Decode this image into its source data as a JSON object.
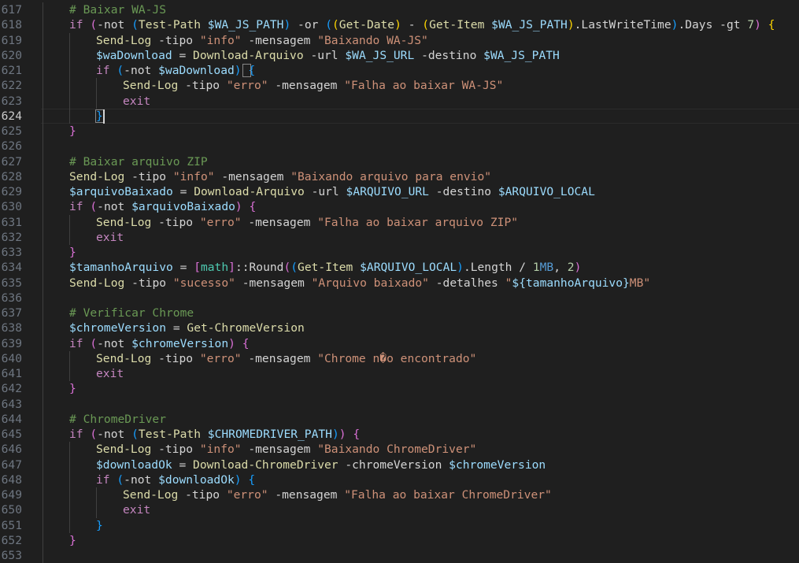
{
  "editor": {
    "cursor_line": 624,
    "lines": [
      {
        "num": "617",
        "indent": 1,
        "tokens": [
          [
            "com",
            "# Baixar WA-JS"
          ]
        ]
      },
      {
        "num": "618",
        "indent": 1,
        "tokens": [
          [
            "kw",
            "if"
          ],
          [
            "txt",
            " "
          ],
          [
            "p2",
            "("
          ],
          [
            "op",
            "-not"
          ],
          [
            "txt",
            " "
          ],
          [
            "p3",
            "("
          ],
          [
            "cmd",
            "Test-Path"
          ],
          [
            "txt",
            " "
          ],
          [
            "var",
            "$WA_JS_PATH"
          ],
          [
            "p3",
            ")"
          ],
          [
            "txt",
            " "
          ],
          [
            "op",
            "-or"
          ],
          [
            "txt",
            " "
          ],
          [
            "p3",
            "("
          ],
          [
            "p1",
            "("
          ],
          [
            "cmd",
            "Get-Date"
          ],
          [
            "p1",
            ")"
          ],
          [
            "txt",
            " "
          ],
          [
            "op",
            "-"
          ],
          [
            "txt",
            " "
          ],
          [
            "p1",
            "("
          ],
          [
            "cmd",
            "Get-Item"
          ],
          [
            "txt",
            " "
          ],
          [
            "var",
            "$WA_JS_PATH"
          ],
          [
            "p1",
            ")"
          ],
          [
            "txt",
            ".LastWriteTime"
          ],
          [
            "p3",
            ")"
          ],
          [
            "txt",
            ".Days "
          ],
          [
            "op",
            "-gt"
          ],
          [
            "txt",
            " "
          ],
          [
            "num",
            "7"
          ],
          [
            "p2",
            ")"
          ],
          [
            "txt",
            " "
          ],
          [
            "p1",
            "{"
          ]
        ]
      },
      {
        "num": "619",
        "indent": 2,
        "tokens": [
          [
            "cmd",
            "Send-Log"
          ],
          [
            "txt",
            " "
          ],
          [
            "op",
            "-tipo"
          ],
          [
            "txt",
            " "
          ],
          [
            "str",
            "\"info\""
          ],
          [
            "txt",
            " "
          ],
          [
            "op",
            "-mensagem"
          ],
          [
            "txt",
            " "
          ],
          [
            "str",
            "\"Baixando WA-JS\""
          ]
        ]
      },
      {
        "num": "620",
        "indent": 2,
        "tokens": [
          [
            "var",
            "$waDownload"
          ],
          [
            "txt",
            " "
          ],
          [
            "op",
            "="
          ],
          [
            "txt",
            " "
          ],
          [
            "cmd",
            "Download-Arquivo"
          ],
          [
            "txt",
            " "
          ],
          [
            "op",
            "-url"
          ],
          [
            "txt",
            " "
          ],
          [
            "var",
            "$WA_JS_URL"
          ],
          [
            "txt",
            " "
          ],
          [
            "op",
            "-destino"
          ],
          [
            "txt",
            " "
          ],
          [
            "var",
            "$WA_JS_PATH"
          ]
        ]
      },
      {
        "num": "621",
        "indent": 2,
        "tokens": [
          [
            "kw",
            "if"
          ],
          [
            "txt",
            " "
          ],
          [
            "p3",
            "("
          ],
          [
            "op",
            "-not"
          ],
          [
            "txt",
            " "
          ],
          [
            "var",
            "$waDownload"
          ],
          [
            "p3",
            ")"
          ],
          [
            "txt",
            " "
          ],
          [
            "p3",
            "{"
          ]
        ]
      },
      {
        "num": "622",
        "indent": 3,
        "tokens": [
          [
            "cmd",
            "Send-Log"
          ],
          [
            "txt",
            " "
          ],
          [
            "op",
            "-tipo"
          ],
          [
            "txt",
            " "
          ],
          [
            "str",
            "\"erro\""
          ],
          [
            "txt",
            " "
          ],
          [
            "op",
            "-mensagem"
          ],
          [
            "txt",
            " "
          ],
          [
            "str",
            "\"Falha ao baixar WA-JS\""
          ]
        ]
      },
      {
        "num": "623",
        "indent": 3,
        "tokens": [
          [
            "kw",
            "exit"
          ]
        ]
      },
      {
        "num": "624",
        "indent": 2,
        "tokens": [
          [
            "p3",
            "}"
          ]
        ]
      },
      {
        "num": "625",
        "indent": 1,
        "tokens": [
          [
            "p2",
            "}"
          ]
        ]
      },
      {
        "num": "626",
        "indent": 0,
        "tokens": []
      },
      {
        "num": "627",
        "indent": 1,
        "tokens": [
          [
            "com",
            "# Baixar arquivo ZIP"
          ]
        ]
      },
      {
        "num": "628",
        "indent": 1,
        "tokens": [
          [
            "cmd",
            "Send-Log"
          ],
          [
            "txt",
            " "
          ],
          [
            "op",
            "-tipo"
          ],
          [
            "txt",
            " "
          ],
          [
            "str",
            "\"info\""
          ],
          [
            "txt",
            " "
          ],
          [
            "op",
            "-mensagem"
          ],
          [
            "txt",
            " "
          ],
          [
            "str",
            "\"Baixando arquivo para envio\""
          ]
        ]
      },
      {
        "num": "629",
        "indent": 1,
        "tokens": [
          [
            "var",
            "$arquivoBaixado"
          ],
          [
            "txt",
            " "
          ],
          [
            "op",
            "="
          ],
          [
            "txt",
            " "
          ],
          [
            "cmd",
            "Download-Arquivo"
          ],
          [
            "txt",
            " "
          ],
          [
            "op",
            "-url"
          ],
          [
            "txt",
            " "
          ],
          [
            "var",
            "$ARQUIVO_URL"
          ],
          [
            "txt",
            " "
          ],
          [
            "op",
            "-destino"
          ],
          [
            "txt",
            " "
          ],
          [
            "var",
            "$ARQUIVO_LOCAL"
          ]
        ]
      },
      {
        "num": "630",
        "indent": 1,
        "tokens": [
          [
            "kw",
            "if"
          ],
          [
            "txt",
            " "
          ],
          [
            "p2",
            "("
          ],
          [
            "op",
            "-not"
          ],
          [
            "txt",
            " "
          ],
          [
            "var",
            "$arquivoBaixado"
          ],
          [
            "p2",
            ")"
          ],
          [
            "txt",
            " "
          ],
          [
            "p2",
            "{"
          ]
        ]
      },
      {
        "num": "631",
        "indent": 2,
        "tokens": [
          [
            "cmd",
            "Send-Log"
          ],
          [
            "txt",
            " "
          ],
          [
            "op",
            "-tipo"
          ],
          [
            "txt",
            " "
          ],
          [
            "str",
            "\"erro\""
          ],
          [
            "txt",
            " "
          ],
          [
            "op",
            "-mensagem"
          ],
          [
            "txt",
            " "
          ],
          [
            "str",
            "\"Falha ao baixar arquivo ZIP\""
          ]
        ]
      },
      {
        "num": "632",
        "indent": 2,
        "tokens": [
          [
            "kw",
            "exit"
          ]
        ]
      },
      {
        "num": "633",
        "indent": 1,
        "tokens": [
          [
            "p2",
            "}"
          ]
        ]
      },
      {
        "num": "634",
        "indent": 1,
        "tokens": [
          [
            "var",
            "$tamanhoArquivo"
          ],
          [
            "txt",
            " "
          ],
          [
            "op",
            "="
          ],
          [
            "txt",
            " "
          ],
          [
            "p2",
            "["
          ],
          [
            "type",
            "math"
          ],
          [
            "p2",
            "]"
          ],
          [
            "txt",
            "::Round"
          ],
          [
            "p2",
            "("
          ],
          [
            "p3",
            "("
          ],
          [
            "cmd",
            "Get-Item"
          ],
          [
            "txt",
            " "
          ],
          [
            "var",
            "$ARQUIVO_LOCAL"
          ],
          [
            "p3",
            ")"
          ],
          [
            "txt",
            ".Length "
          ],
          [
            "op",
            "/"
          ],
          [
            "txt",
            " "
          ],
          [
            "num",
            "1"
          ],
          [
            "unit",
            "MB"
          ],
          [
            "txt",
            ", "
          ],
          [
            "num",
            "2"
          ],
          [
            "p2",
            ")"
          ]
        ]
      },
      {
        "num": "635",
        "indent": 1,
        "tokens": [
          [
            "cmd",
            "Send-Log"
          ],
          [
            "txt",
            " "
          ],
          [
            "op",
            "-tipo"
          ],
          [
            "txt",
            " "
          ],
          [
            "str",
            "\"sucesso\""
          ],
          [
            "txt",
            " "
          ],
          [
            "op",
            "-mensagem"
          ],
          [
            "txt",
            " "
          ],
          [
            "str",
            "\"Arquivo baixado\""
          ],
          [
            "txt",
            " "
          ],
          [
            "op",
            "-detalhes"
          ],
          [
            "txt",
            " "
          ],
          [
            "str",
            "\""
          ],
          [
            "var",
            "${tamanhoArquivo}"
          ],
          [
            "str",
            "MB\""
          ]
        ]
      },
      {
        "num": "636",
        "indent": 0,
        "tokens": []
      },
      {
        "num": "637",
        "indent": 1,
        "tokens": [
          [
            "com",
            "# Verificar Chrome"
          ]
        ]
      },
      {
        "num": "638",
        "indent": 1,
        "tokens": [
          [
            "var",
            "$chromeVersion"
          ],
          [
            "txt",
            " "
          ],
          [
            "op",
            "="
          ],
          [
            "txt",
            " "
          ],
          [
            "cmd",
            "Get-ChromeVersion"
          ]
        ]
      },
      {
        "num": "639",
        "indent": 1,
        "tokens": [
          [
            "kw",
            "if"
          ],
          [
            "txt",
            " "
          ],
          [
            "p2",
            "("
          ],
          [
            "op",
            "-not"
          ],
          [
            "txt",
            " "
          ],
          [
            "var",
            "$chromeVersion"
          ],
          [
            "p2",
            ")"
          ],
          [
            "txt",
            " "
          ],
          [
            "p2",
            "{"
          ]
        ]
      },
      {
        "num": "640",
        "indent": 2,
        "tokens": [
          [
            "cmd",
            "Send-Log"
          ],
          [
            "txt",
            " "
          ],
          [
            "op",
            "-tipo"
          ],
          [
            "txt",
            " "
          ],
          [
            "str",
            "\"erro\""
          ],
          [
            "txt",
            " "
          ],
          [
            "op",
            "-mensagem"
          ],
          [
            "txt",
            " "
          ],
          [
            "str",
            "\"Chrome n�o encontrado\""
          ]
        ]
      },
      {
        "num": "641",
        "indent": 2,
        "tokens": [
          [
            "kw",
            "exit"
          ]
        ]
      },
      {
        "num": "642",
        "indent": 1,
        "tokens": [
          [
            "p2",
            "}"
          ]
        ]
      },
      {
        "num": "643",
        "indent": 0,
        "tokens": []
      },
      {
        "num": "644",
        "indent": 1,
        "tokens": [
          [
            "com",
            "# ChromeDriver"
          ]
        ]
      },
      {
        "num": "645",
        "indent": 1,
        "tokens": [
          [
            "kw",
            "if"
          ],
          [
            "txt",
            " "
          ],
          [
            "p2",
            "("
          ],
          [
            "op",
            "-not"
          ],
          [
            "txt",
            " "
          ],
          [
            "p3",
            "("
          ],
          [
            "cmd",
            "Test-Path"
          ],
          [
            "txt",
            " "
          ],
          [
            "var",
            "$CHROMEDRIVER_PATH"
          ],
          [
            "p3",
            ")"
          ],
          [
            "p2",
            ")"
          ],
          [
            "txt",
            " "
          ],
          [
            "p2",
            "{"
          ]
        ]
      },
      {
        "num": "646",
        "indent": 2,
        "tokens": [
          [
            "cmd",
            "Send-Log"
          ],
          [
            "txt",
            " "
          ],
          [
            "op",
            "-tipo"
          ],
          [
            "txt",
            " "
          ],
          [
            "str",
            "\"info\""
          ],
          [
            "txt",
            " "
          ],
          [
            "op",
            "-mensagem"
          ],
          [
            "txt",
            " "
          ],
          [
            "str",
            "\"Baixando ChromeDriver\""
          ]
        ]
      },
      {
        "num": "647",
        "indent": 2,
        "tokens": [
          [
            "var",
            "$downloadOk"
          ],
          [
            "txt",
            " "
          ],
          [
            "op",
            "="
          ],
          [
            "txt",
            " "
          ],
          [
            "cmd",
            "Download-ChromeDriver"
          ],
          [
            "txt",
            " "
          ],
          [
            "op",
            "-chromeVersion"
          ],
          [
            "txt",
            " "
          ],
          [
            "var",
            "$chromeVersion"
          ]
        ]
      },
      {
        "num": "648",
        "indent": 2,
        "tokens": [
          [
            "kw",
            "if"
          ],
          [
            "txt",
            " "
          ],
          [
            "p3",
            "("
          ],
          [
            "op",
            "-not"
          ],
          [
            "txt",
            " "
          ],
          [
            "var",
            "$downloadOk"
          ],
          [
            "p3",
            ")"
          ],
          [
            "txt",
            " "
          ],
          [
            "p3",
            "{"
          ]
        ]
      },
      {
        "num": "649",
        "indent": 3,
        "tokens": [
          [
            "cmd",
            "Send-Log"
          ],
          [
            "txt",
            " "
          ],
          [
            "op",
            "-tipo"
          ],
          [
            "txt",
            " "
          ],
          [
            "str",
            "\"erro\""
          ],
          [
            "txt",
            " "
          ],
          [
            "op",
            "-mensagem"
          ],
          [
            "txt",
            " "
          ],
          [
            "str",
            "\"Falha ao baixar ChromeDriver\""
          ]
        ]
      },
      {
        "num": "650",
        "indent": 3,
        "tokens": [
          [
            "kw",
            "exit"
          ]
        ]
      },
      {
        "num": "651",
        "indent": 2,
        "tokens": [
          [
            "p3",
            "}"
          ]
        ]
      },
      {
        "num": "652",
        "indent": 1,
        "tokens": [
          [
            "p2",
            "}"
          ]
        ]
      },
      {
        "num": "653",
        "indent": 0,
        "tokens": []
      }
    ]
  }
}
